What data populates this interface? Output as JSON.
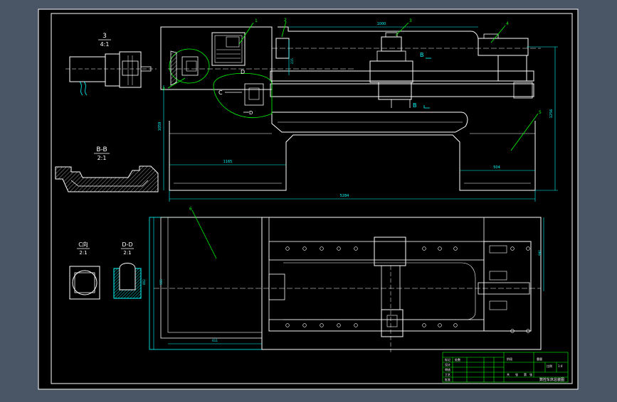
{
  "colors": {
    "background": "#4a5566",
    "sheet": "#000000",
    "line": "#ffffff",
    "dimension": "#00ffff",
    "leader": "#00ff00",
    "table": "#00ff00",
    "hatch": "#00ffff"
  },
  "views": {
    "detail3": {
      "number": "3",
      "scale": "4:1"
    },
    "section_bb": {
      "title": "B-B",
      "scale": "2:1"
    },
    "view_c": {
      "title": "C向",
      "scale": "2:1"
    },
    "section_dd": {
      "title": "D-D",
      "scale": "2:1"
    }
  },
  "front_view": {
    "balloons": [
      "1",
      "2",
      "3",
      "4",
      "5"
    ],
    "section_markers": {
      "b_top": "B",
      "b_bottom": "B",
      "c": "C",
      "d_top": "D",
      "d_bottom": "D",
      "detail": "3"
    },
    "dimensions": {
      "top_length": "1000",
      "total_length": "5284",
      "height_left": "1059",
      "height_right": "1256",
      "base_left": "1165",
      "base_right": "504",
      "small_vertical": "215"
    }
  },
  "plan_view": {
    "balloon": "6",
    "dimensions": {
      "bed_width": "990",
      "left_height": "802",
      "bottom_left": "611",
      "right_height": "555"
    }
  },
  "title_block": {
    "title": "数控车床总装图",
    "labels": [
      "标记",
      "处数",
      "设计",
      "审核",
      "工艺",
      "批准",
      "阶段",
      "重量",
      "比例",
      "共",
      "张",
      "第",
      "张"
    ],
    "scale": "1:4"
  }
}
